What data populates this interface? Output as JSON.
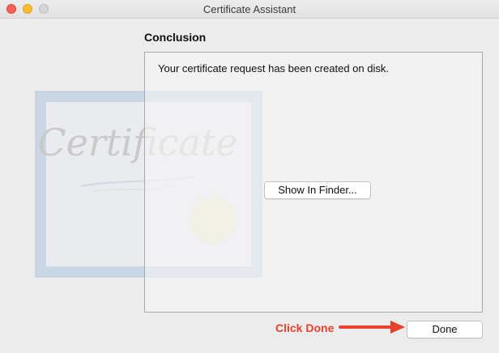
{
  "window": {
    "title": "Certificate Assistant"
  },
  "page": {
    "heading": "Conclusion",
    "message": "Your certificate request has been created on disk."
  },
  "buttons": {
    "show_in_finder": "Show In Finder...",
    "done": "Done"
  },
  "annotation": {
    "text": "Click Done",
    "color": "#e8412c"
  },
  "certificate_art": {
    "script_text": "Certificate"
  }
}
